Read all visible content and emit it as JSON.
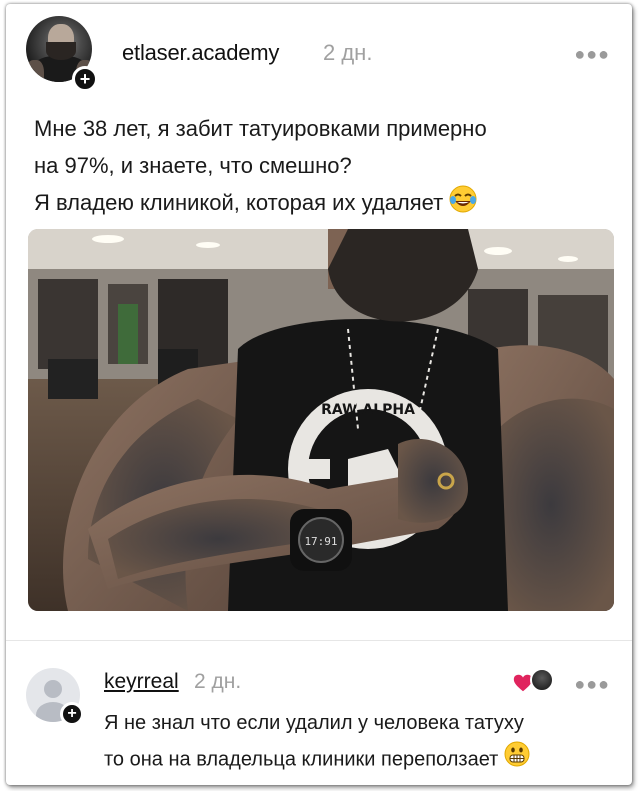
{
  "post": {
    "author": "etlaser.academy",
    "time": "2 дн.",
    "more_icon": "ellipsis-icon",
    "text_lines": [
      "Мне 38 лет, я забит татуировками примерно",
      "на 97%, и знаете, что смешно?",
      "Я владею клиникой, которая их удаляет"
    ],
    "line_emoji": "face-with-tears-of-joy-icon",
    "photo_logo_text": "RAW ALPHA",
    "watch_text": "17:91"
  },
  "comment": {
    "author": "keyrreal",
    "time": "2 дн.",
    "reaction_icons": [
      "heart-icon",
      "reaction-avatar"
    ],
    "text_lines": [
      "Я не знал что если удалил у человека татуху",
      "то она на владельца клиники переползает"
    ],
    "line_emoji": "grimacing-face-icon"
  },
  "colors": {
    "text": "#1a1a1a",
    "muted": "#a0a0a0",
    "heart": "#e0245e",
    "emoji": "#ffcc33"
  }
}
